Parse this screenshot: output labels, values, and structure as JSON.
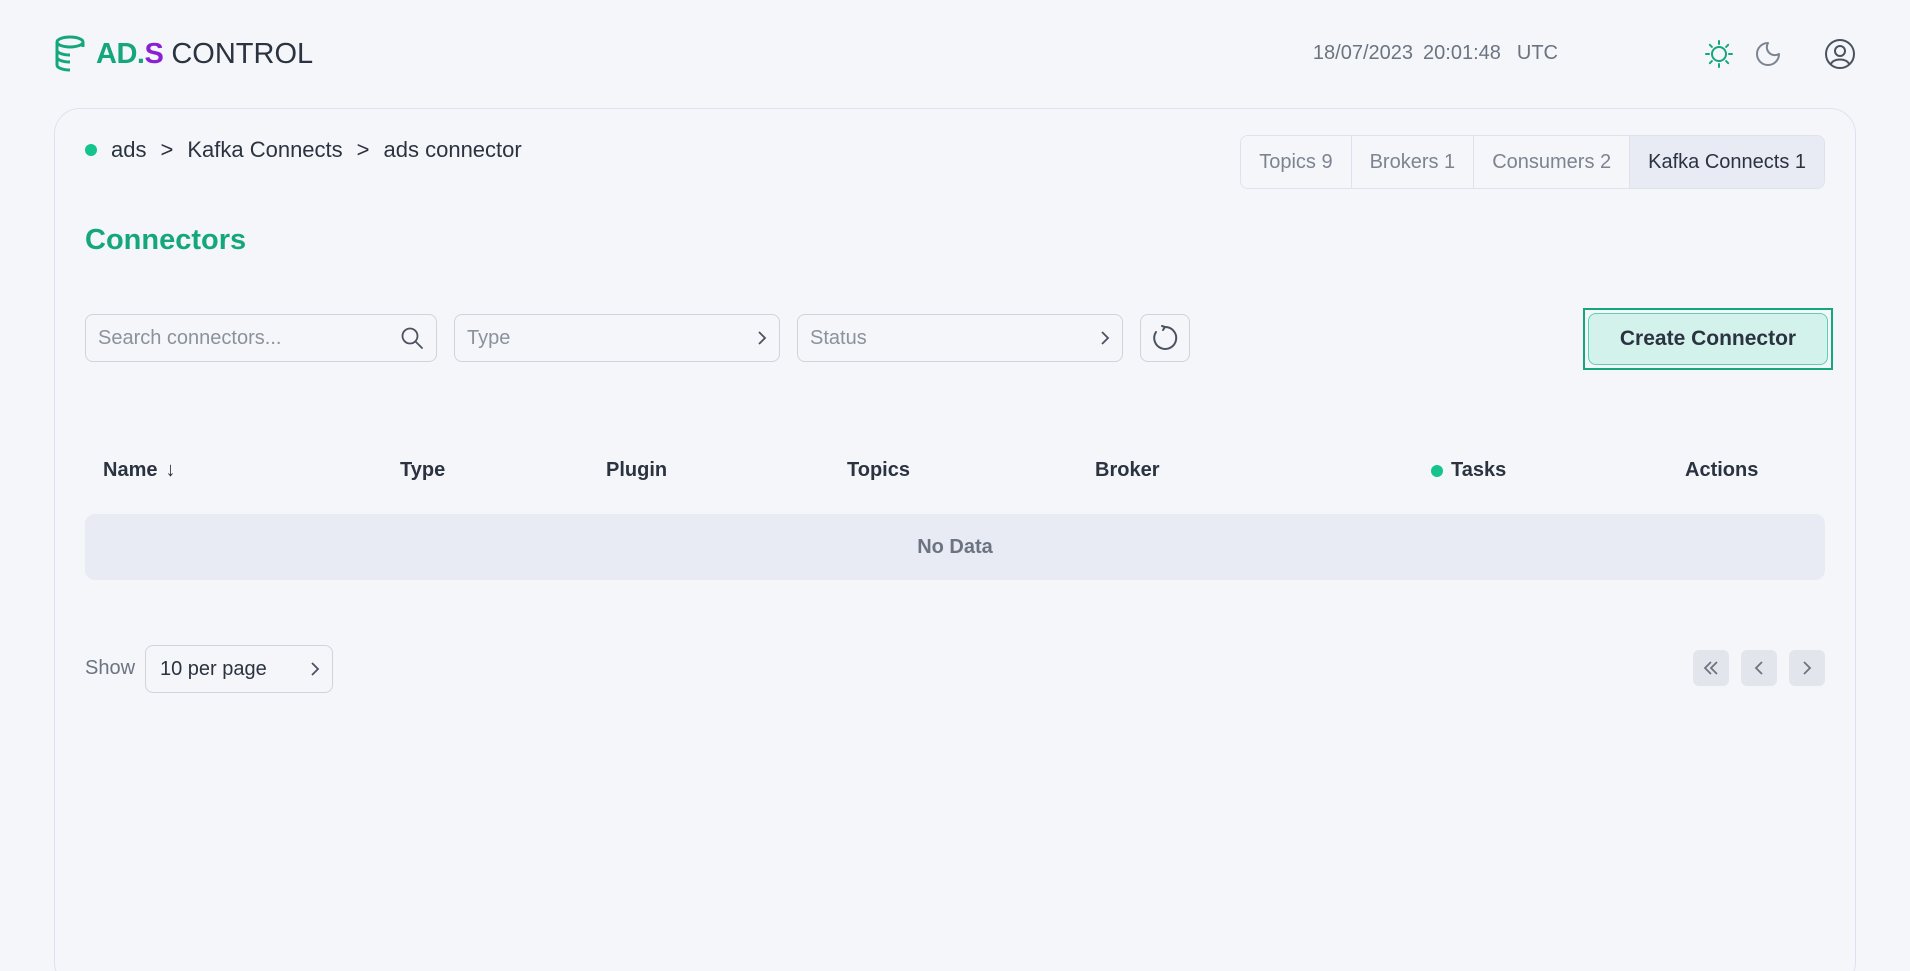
{
  "header": {
    "logo": {
      "ad": "AD",
      "dot": ".",
      "s": "S",
      "control": " CONTROL"
    },
    "clock": {
      "date": "18/07/2023",
      "time": "20:01:48",
      "tz": "UTC"
    },
    "icons": {
      "light_theme": "sun-icon",
      "dark_theme": "moon-icon",
      "user": "user-icon"
    },
    "accent_color": "#14a77c",
    "brand_purple": "#8a1fd6"
  },
  "breadcrumb": {
    "cluster": "ads",
    "section": "Kafka Connects",
    "current": "ads connector",
    "separator": ">",
    "status_color": "#14c48b"
  },
  "tabs": [
    {
      "label": "Topics 9"
    },
    {
      "label": "Brokers 1"
    },
    {
      "label": "Consumers 2"
    },
    {
      "label": "Kafka Connects 1",
      "active": true
    }
  ],
  "page": {
    "title": "Connectors"
  },
  "filters": {
    "search_placeholder": "Search connectors...",
    "type_placeholder": "Type",
    "status_placeholder": "Status",
    "refresh_icon": "refresh-icon",
    "create_label": "Create Connector"
  },
  "table": {
    "columns": [
      "Name",
      "Type",
      "Plugin",
      "Topics",
      "Broker",
      "Tasks",
      "Actions"
    ],
    "sort_indicator": "↓",
    "empty_text": "No Data"
  },
  "pagination": {
    "show_label": "Show",
    "per_page": "10 per page"
  }
}
